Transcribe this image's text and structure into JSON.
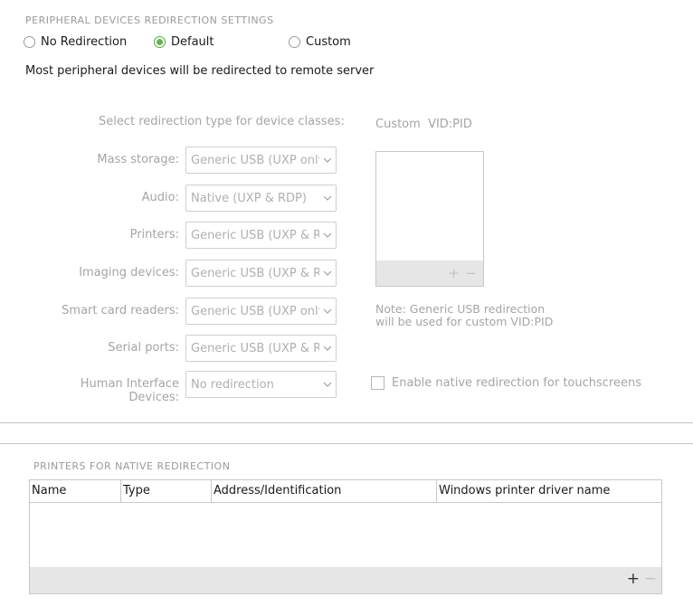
{
  "redirection_section": {
    "title": "PERIPHERAL DEVICES REDIRECTION SETTINGS",
    "options": [
      {
        "label": "No Redirection",
        "checked": false
      },
      {
        "label": "Default",
        "checked": true
      },
      {
        "label": "Custom",
        "checked": false
      }
    ],
    "description": "Most peripheral devices will be redirected to remote server"
  },
  "device_classes": {
    "heading": "Select redirection type for device classes:",
    "rows": [
      {
        "label": "Mass storage:",
        "value": "Generic USB (UXP only)"
      },
      {
        "label": "Audio:",
        "value": "Native (UXP & RDP)"
      },
      {
        "label": "Printers:",
        "value": "Generic USB (UXP & RDP)"
      },
      {
        "label": "Imaging devices:",
        "value": "Generic USB (UXP & RDP)"
      },
      {
        "label": "Smart card readers:",
        "value": "Generic USB (UXP only)"
      },
      {
        "label": "Serial ports:",
        "value": "Generic USB (UXP & RDP)"
      },
      {
        "label": "Human Interface Devices:",
        "value": "No redirection"
      }
    ]
  },
  "custom_vidpid": {
    "heading": "Custom  VID:PID",
    "add_symbol": "+",
    "remove_symbol": "−",
    "note_line1": "Note: Generic USB redirection",
    "note_line2": "will be used for custom VID:PID"
  },
  "touchscreen": {
    "label": "Enable native redirection for touchscreens",
    "checked": false
  },
  "printers_section": {
    "title": "PRINTERS FOR NATIVE REDIRECTION",
    "columns": [
      "Name",
      "Type",
      "Address/Identification",
      "Windows printer driver name"
    ],
    "rows": [],
    "add_symbol": "+",
    "remove_symbol": "−"
  },
  "colors": {
    "accent_green": "#5cb946",
    "muted_text": "#a5a5a5"
  }
}
